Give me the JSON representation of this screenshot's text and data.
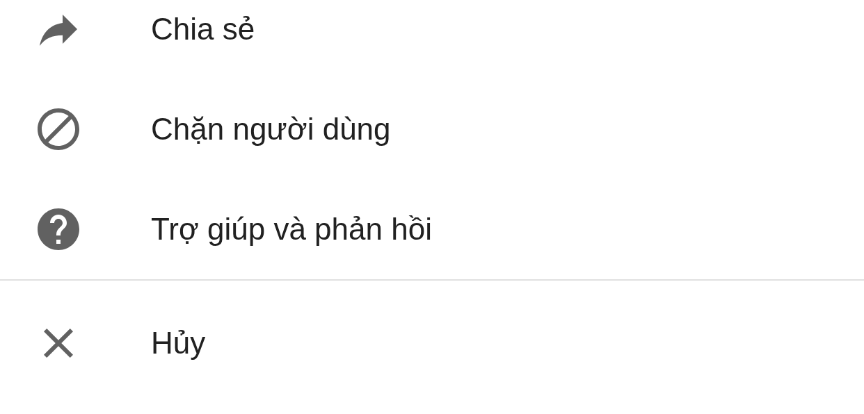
{
  "sections": [
    {
      "items": [
        {
          "kind": "share",
          "label": "Chia sẻ"
        },
        {
          "kind": "block",
          "label": "Chặn người dùng"
        },
        {
          "kind": "help",
          "label": "Trợ giúp và phản hồi"
        }
      ]
    },
    {
      "items": [
        {
          "kind": "close",
          "label": "Hủy"
        }
      ]
    }
  ]
}
